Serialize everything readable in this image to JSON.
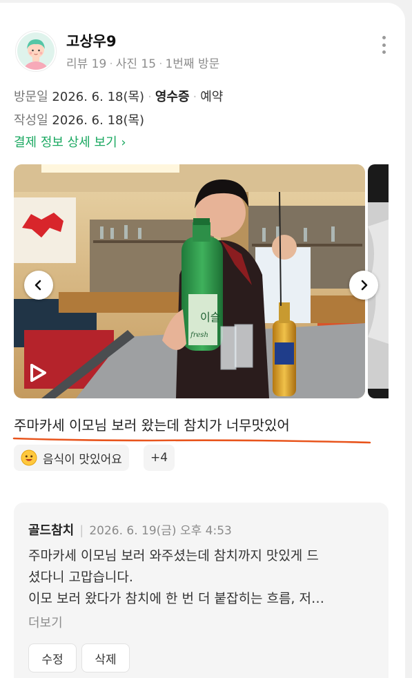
{
  "user": {
    "name": "고상우9",
    "stats": [
      "리뷰 19",
      "사진 15",
      "1번째 방문"
    ],
    "avatar_icon": "user-avatar-icon"
  },
  "meta": {
    "visit_label": "방문일",
    "visit_date": "2026. 6. 18(목)",
    "verify": "영수증",
    "booking": "예약",
    "written_label": "작성일",
    "written_date": "2026. 6. 18(목)",
    "payment_link": "결제 정보 상세 보기 ›"
  },
  "photo": {
    "prev_icon": "chevron-left-icon",
    "next_icon": "chevron-right-icon",
    "video_icon": "play-icon"
  },
  "review": {
    "text": "주마카세 이모님 보러 왔는데 참치가 너무맛있어",
    "tag_label": "음식이 맛있어요",
    "tag_more": "+4",
    "underline_color": "#e8541c"
  },
  "reply": {
    "owner": "골드참치",
    "date": "2026. 6. 19(금) 오후 4:53",
    "lines": [
      "주마카세 이모님 보러 와주셨는데 참치까지 맛있게 드",
      "셨다니 고맙습니다.",
      "이모 보러 왔다가 참치에 한 번 더 붙잡히는 흐름, 저…"
    ],
    "more": "더보기",
    "edit": "수정",
    "delete": "삭제"
  },
  "colors": {
    "accent_green": "#1aa860",
    "background": "#f1f1f1"
  }
}
